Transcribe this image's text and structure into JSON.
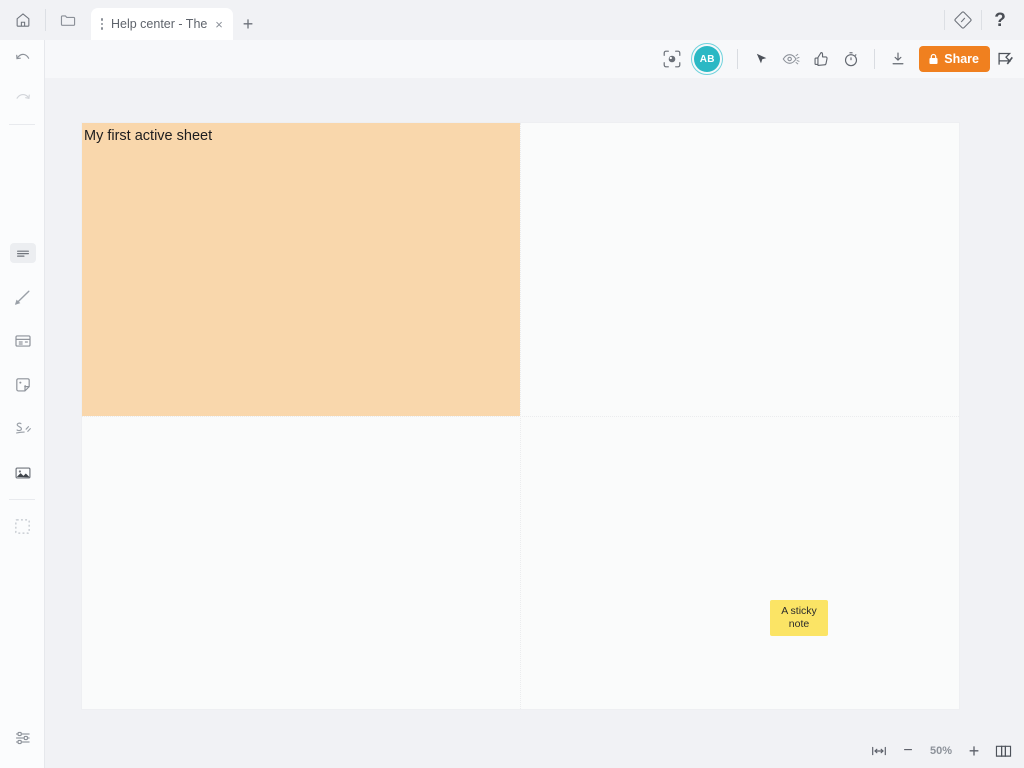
{
  "window": {
    "home_icon": "home-icon",
    "folder_icon": "folder-icon",
    "diamond_icon": "diamond-slash-icon",
    "help_label": "?"
  },
  "tabs": {
    "items": [
      {
        "title": "Help center - The ...",
        "close_label": "×",
        "menu_icon": "tab-menu-icon",
        "active": true
      }
    ],
    "add_label": "+"
  },
  "toolbar": {
    "focus_icon": "focus-frame-icon",
    "avatar": {
      "initials": "AB",
      "color": "#2bb8c4"
    },
    "pointer_icon": "cursor-pointer-icon",
    "presence_icon": "eye-motion-icon",
    "like_icon": "thumbs-up-icon",
    "timer_icon": "stopwatch-icon",
    "download_icon": "download-icon",
    "share": {
      "label": "Share",
      "lock_icon": "lock-icon",
      "color": "#f0801f"
    },
    "flag_icon": "flag-cut-icon"
  },
  "sidebar": {
    "items": [
      {
        "name": "undo",
        "icon": "undo-arrow-icon",
        "enabled": true
      },
      {
        "name": "redo",
        "icon": "redo-arrow-icon",
        "enabled": false
      },
      {
        "name": "text",
        "icon": "text-block-icon",
        "active": true
      },
      {
        "name": "pen",
        "icon": "pen-icon",
        "active": false
      },
      {
        "name": "card",
        "icon": "card-layout-icon",
        "active": false
      },
      {
        "name": "sticky-note",
        "icon": "sticky-note-tag-icon",
        "active": false
      },
      {
        "name": "scribble",
        "icon": "scribble-icon",
        "active": false
      },
      {
        "name": "image",
        "icon": "image-icon",
        "active": false
      },
      {
        "name": "frame",
        "icon": "dashed-frame-icon",
        "active": false
      }
    ],
    "settings_icon": "sliders-settings-icon"
  },
  "canvas": {
    "sheet_title": "My first active sheet",
    "sheet_fill": "#f9d7ac",
    "board_fill": "#fafbfb",
    "sticky_note": {
      "text": "A sticky note",
      "color": "#fbe465"
    }
  },
  "statusbar": {
    "fit_icon": "fit-width-icon",
    "zoom_out_label": "−",
    "zoom_level": "50%",
    "zoom_in_label": "+",
    "pages_icon": "book-pages-icon"
  }
}
